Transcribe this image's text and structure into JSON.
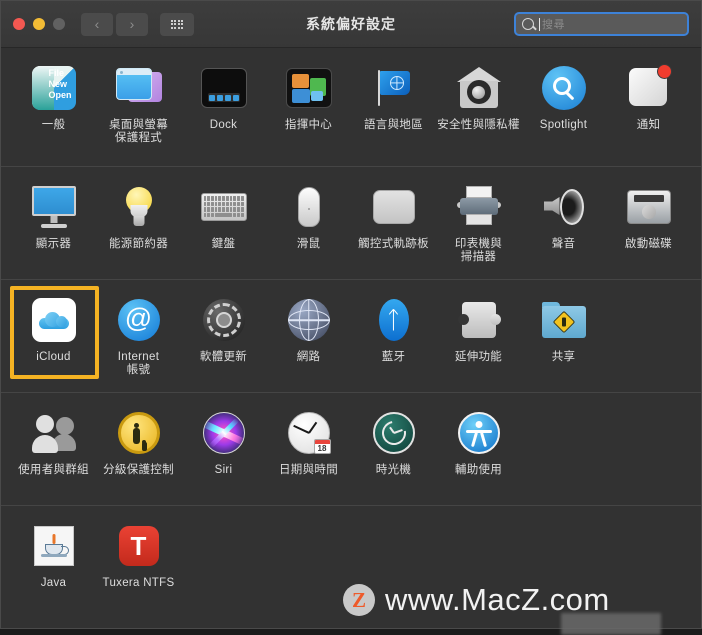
{
  "window": {
    "title": "系統偏好設定",
    "traffic_lights": [
      "close",
      "minimize",
      "zoom"
    ]
  },
  "toolbar": {
    "back_glyph": "‹",
    "forward_glyph": "›",
    "grid_icon": "grid-view-icon",
    "search": {
      "placeholder": "搜尋",
      "value": ""
    }
  },
  "rows": [
    {
      "id": "row-1",
      "items": [
        {
          "label": "一般",
          "icon": "general-icon",
          "extra": "File\nNew\nOpen"
        },
        {
          "label": "桌面與螢幕\n保護程式",
          "icon": "desktop-screensaver-icon"
        },
        {
          "label": "Dock",
          "icon": "dock-icon"
        },
        {
          "label": "指揮中心",
          "icon": "mission-control-icon"
        },
        {
          "label": "語言與地區",
          "icon": "language-region-icon"
        },
        {
          "label": "安全性與隱私權",
          "icon": "security-privacy-icon"
        },
        {
          "label": "Spotlight",
          "icon": "spotlight-icon"
        },
        {
          "label": "通知",
          "icon": "notifications-icon",
          "badge": true
        }
      ]
    },
    {
      "id": "row-2",
      "items": [
        {
          "label": "顯示器",
          "icon": "displays-icon"
        },
        {
          "label": "能源節約器",
          "icon": "energy-saver-icon"
        },
        {
          "label": "鍵盤",
          "icon": "keyboard-icon"
        },
        {
          "label": "滑鼠",
          "icon": "mouse-icon"
        },
        {
          "label": "觸控式軌跡板",
          "icon": "trackpad-icon"
        },
        {
          "label": "印表機與\n掃描器",
          "icon": "printers-scanners-icon"
        },
        {
          "label": "聲音",
          "icon": "sound-icon"
        },
        {
          "label": "啟動磁碟",
          "icon": "startup-disk-icon"
        }
      ]
    },
    {
      "id": "row-3",
      "items": [
        {
          "label": "iCloud",
          "icon": "icloud-icon",
          "selected": true
        },
        {
          "label": "Internet\n帳號",
          "icon": "internet-accounts-icon"
        },
        {
          "label": "軟體更新",
          "icon": "software-update-icon"
        },
        {
          "label": "網路",
          "icon": "network-icon"
        },
        {
          "label": "藍牙",
          "icon": "bluetooth-icon"
        },
        {
          "label": "延伸功能",
          "icon": "extensions-icon"
        },
        {
          "label": "共享",
          "icon": "sharing-icon"
        }
      ]
    },
    {
      "id": "row-4",
      "items": [
        {
          "label": "使用者與群組",
          "icon": "users-groups-icon"
        },
        {
          "label": "分級保護控制",
          "icon": "parental-controls-icon"
        },
        {
          "label": "Siri",
          "icon": "siri-icon"
        },
        {
          "label": "日期與時間",
          "icon": "date-time-icon",
          "day": "18"
        },
        {
          "label": "時光機",
          "icon": "time-machine-icon"
        },
        {
          "label": "輔助使用",
          "icon": "accessibility-icon"
        }
      ]
    },
    {
      "id": "row-5",
      "items": [
        {
          "label": "Java",
          "icon": "java-icon"
        },
        {
          "label": "Tuxera NTFS",
          "icon": "tuxera-ntfs-icon",
          "letter": "T"
        }
      ]
    }
  ],
  "watermark": {
    "logo_letter": "Z",
    "text": "www.MacZ.com"
  },
  "colors": {
    "window_bg": "#323232",
    "titlebar_bg": "#3a3a3a",
    "selection_highlight": "#f5b323",
    "search_focus_border": "#3d82d8",
    "label_text": "#dedede",
    "watermark_accent": "#ee5a2a"
  }
}
